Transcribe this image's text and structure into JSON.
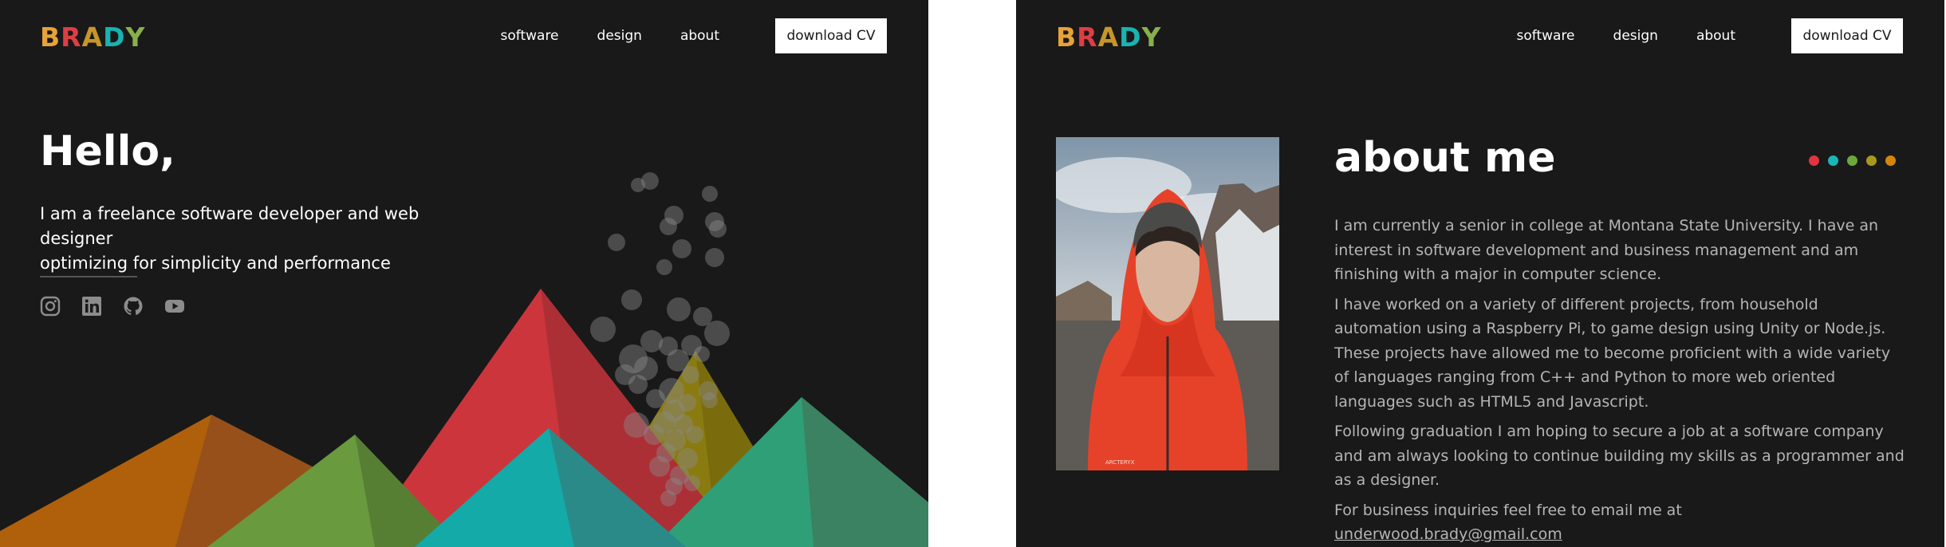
{
  "brand": {
    "letters": [
      "B",
      "R",
      "A",
      "D",
      "Y"
    ],
    "letter_colors": [
      "#e8a23a",
      "#dd3e44",
      "#c7962a",
      "#19b3b0",
      "#88b04a"
    ]
  },
  "nav": {
    "software": "software",
    "design": "design",
    "about": "about",
    "download_cv": "download CV"
  },
  "hero": {
    "title": "Hello,",
    "line1": "I am a freelance software developer and web designer",
    "line2": "optimizing for simplicity and performance"
  },
  "socials": [
    "instagram-icon",
    "linkedin-icon",
    "github-icon",
    "youtube-icon"
  ],
  "about": {
    "title": "about me",
    "dot_colors": [
      "#e03540",
      "#1ab5b5",
      "#6da83c",
      "#a69a1c",
      "#d4860c"
    ],
    "paragraphs": [
      "I am currently a senior in college at Montana State University. I have an interest in software development and business management and am finishing with a major in computer science.",
      "I have worked on a variety of different projects, from household automation using a Raspberry Pi, to game design using Unity or Node.js. These projects have allowed me to become proficient with a wide variety of languages ranging from C++ and Python to more web oriented languages such as HTML5 and Javascript.",
      "Following graduation I am hoping to secure a job at a software company and am always looking to continue building my skills as a programmer and as a designer."
    ],
    "contact_prefix": "For business inquiries feel free to email me at ",
    "email": "underwood.brady@gmail.com"
  },
  "colors": {
    "background": "#191919",
    "orange": "#b0600a",
    "green": "#6a9a3e",
    "red": "#cc353c",
    "olive": "#8a7b10",
    "teal": "#13aaa8",
    "emerald": "#2f9f78"
  }
}
